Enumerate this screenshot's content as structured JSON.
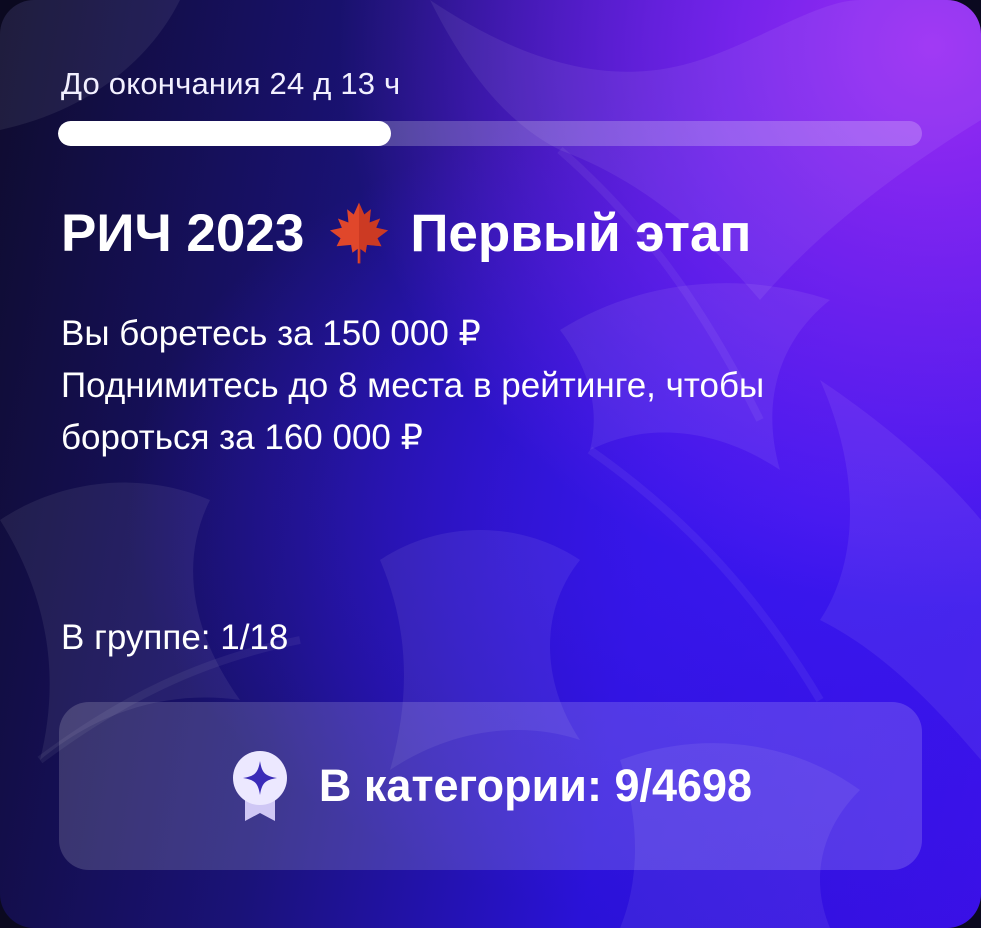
{
  "countdown": {
    "text": "До окончания 24 д 13 ч",
    "progress_fraction": 0.385
  },
  "title": {
    "before_icon": "РИЧ 2023",
    "icon": "maple-leaf-icon",
    "after_icon": "Первый этап"
  },
  "description": {
    "line1": "Вы боретесь за 150 000 ₽",
    "line2": "Поднимитесь до 8 места в рейтинге, чтобы",
    "line3": "бороться за 160 000 ₽"
  },
  "group_rank": "В группе: 1/18",
  "category": {
    "icon": "star-badge-icon",
    "label": "В категории: 9/4698"
  },
  "colors": {
    "background_dark": "#0f0c2e",
    "background_accent": "#3a10e6",
    "highlight": "#9a2cf4",
    "maple_leaf": "#e0472b",
    "text": "#ffffff"
  }
}
